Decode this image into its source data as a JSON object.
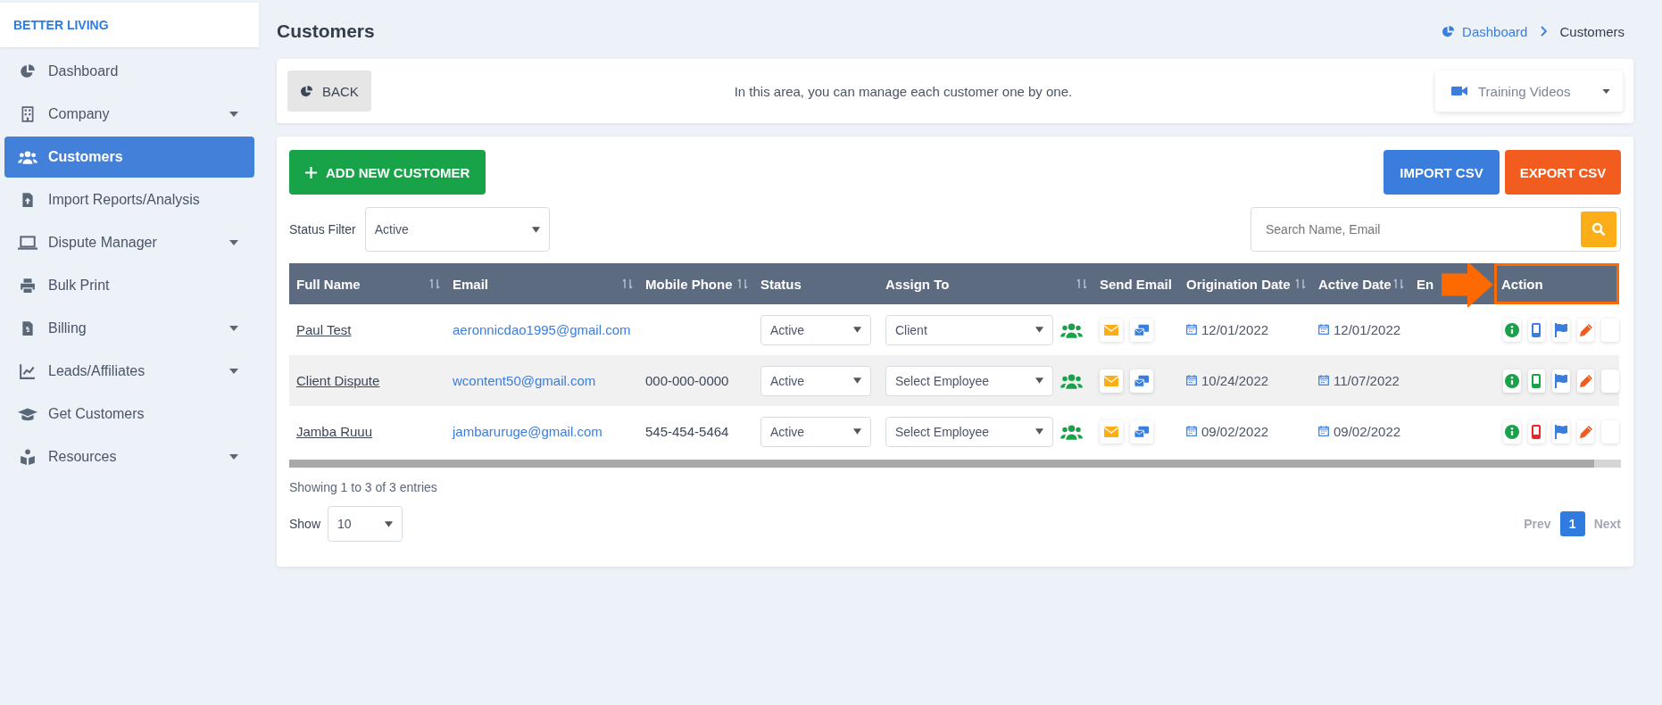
{
  "sidebar": {
    "brand": "BETTER LIVING",
    "items": [
      {
        "label": "Dashboard",
        "selected": false,
        "has_submenu": false
      },
      {
        "label": "Company",
        "selected": false,
        "has_submenu": true
      },
      {
        "label": "Customers",
        "selected": true,
        "has_submenu": false
      },
      {
        "label": "Import Reports/Analysis",
        "selected": false,
        "has_submenu": false
      },
      {
        "label": "Dispute Manager",
        "selected": false,
        "has_submenu": true
      },
      {
        "label": "Bulk Print",
        "selected": false,
        "has_submenu": false
      },
      {
        "label": "Billing",
        "selected": false,
        "has_submenu": true
      },
      {
        "label": "Leads/Affiliates",
        "selected": false,
        "has_submenu": true
      },
      {
        "label": "Get Customers",
        "selected": false,
        "has_submenu": false
      },
      {
        "label": "Resources",
        "selected": false,
        "has_submenu": true
      }
    ]
  },
  "page_title": "Customers",
  "breadcrumb": [
    {
      "label": "Dashboard",
      "link": true
    },
    {
      "label": "Customers",
      "link": false
    }
  ],
  "info_bar": {
    "back_button": "BACK",
    "message": "In this area, you can manage each customer one by one.",
    "training_dropdown": "Training Videos"
  },
  "toolbar": {
    "add_button": "ADD NEW CUSTOMER",
    "import_button": "IMPORT CSV",
    "export_button": "EXPORT CSV",
    "status_filter_label": "Status Filter",
    "status_filter_value": "Active",
    "search_placeholder": "Search Name, Email"
  },
  "table": {
    "columns": [
      {
        "label": "Full Name",
        "sortable": true,
        "highlighted": false
      },
      {
        "label": "Email",
        "sortable": true,
        "highlighted": false
      },
      {
        "label": "Mobile Phone",
        "sortable": true,
        "highlighted": false
      },
      {
        "label": "Status",
        "sortable": false,
        "highlighted": false
      },
      {
        "label": "Assign To",
        "sortable": true,
        "highlighted": false
      },
      {
        "label": "Send Email",
        "sortable": false,
        "highlighted": false
      },
      {
        "label": "Origination Date",
        "sortable": true,
        "highlighted": false
      },
      {
        "label": "Active Date",
        "sortable": true,
        "highlighted": false
      },
      {
        "label": "En",
        "sortable": false,
        "highlighted": false
      },
      {
        "label": "Action",
        "sortable": false,
        "highlighted": true
      }
    ],
    "rows": [
      {
        "name": "Paul Test",
        "email": "aeronnicdao1995@gmail.com",
        "status": "Active",
        "assign_to": "Client",
        "origination_date": "12/01/2022",
        "active_date": "12/01/2022",
        "color": "#3b7ddd"
      },
      {
        "name": "Client Dispute",
        "email": "wcontent50@gmail.com",
        "phone": "000-000-0000",
        "status": "Active",
        "assign_to": "Select Employee",
        "origination_date": "10/24/2022",
        "active_date": "11/07/2022",
        "color": "#1aa14a"
      },
      {
        "name": "Jamba Ruuu",
        "email": "jambaruruge@gmail.com",
        "phone": "545-454-5464",
        "status": "Active",
        "assign_to": "Select Employee",
        "origination_date": "09/02/2022",
        "active_date": "09/02/2022",
        "color": "#e8262b"
      }
    ]
  },
  "footer": {
    "entries_info": "Showing 1 to 3 of 3 entries",
    "show_label": "Show",
    "page_size": "10",
    "prev": {
      "label": "Prev",
      "disabled": true
    },
    "pages": [
      {
        "label": "1",
        "selected": true
      }
    ],
    "next": {
      "label": "Next",
      "disabled": true
    }
  }
}
